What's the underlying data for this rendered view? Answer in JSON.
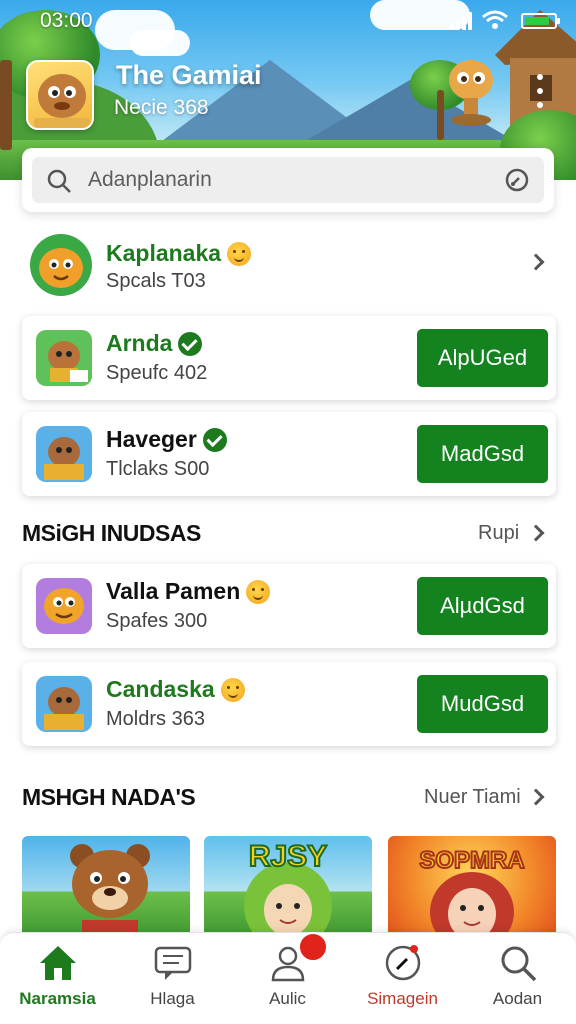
{
  "status_bar": {
    "time": "03:00"
  },
  "header": {
    "title": "The Gamiai",
    "subtitle": "Necie 368",
    "icons": [
      "app-icon",
      "signal-icon",
      "wifi-icon",
      "battery-icon",
      "more-icon"
    ]
  },
  "search": {
    "placeholder": "Adanplanarin"
  },
  "friends": [
    {
      "name": "Kaplanaka",
      "sub": "Spcals T03",
      "badge": "smile-emoji",
      "action": ""
    },
    {
      "name": "Arnda",
      "sub": "Speufc 402",
      "badge": "verified-check",
      "action": "AlpUGed"
    },
    {
      "name": "Haveger",
      "sub": "Tlclaks S00",
      "badge": "verified-check",
      "action": "MadGsd"
    }
  ],
  "section1": {
    "title": "MSiGH INUDSAS",
    "link": "Rupi",
    "items": [
      {
        "name": "Valla Pamen",
        "sub": "Spafes 300",
        "badge": "smile-emoji",
        "action": "AlµdGsd"
      },
      {
        "name": "Candaska",
        "sub": "Moldrs 363",
        "badge": "smile-emoji",
        "action": "MudGsd"
      }
    ]
  },
  "section2": {
    "title": "MSHGH NADA'S",
    "link": "Nuer Tiami",
    "tiles": [
      {
        "text": "",
        "art": "bear"
      },
      {
        "text": "RJSY",
        "art": "green-hair-girl"
      },
      {
        "text": "SOPMRA",
        "art": "red-hair-girl"
      }
    ]
  },
  "nav": [
    {
      "label": "Naramsia",
      "icon": "home-icon",
      "active": true
    },
    {
      "label": "Hlaga",
      "icon": "chat-icon",
      "active": false
    },
    {
      "label": "Aulic",
      "icon": "profile-icon",
      "active": false
    },
    {
      "label": "Simagein",
      "icon": "compass-icon",
      "active": false
    },
    {
      "label": "Aodan",
      "icon": "search-icon",
      "active": false
    }
  ],
  "colors": {
    "primary_green": "#14821f",
    "name_green": "#1d7a1d",
    "notification_red": "#e0241b",
    "sky": "#39a9ec"
  }
}
